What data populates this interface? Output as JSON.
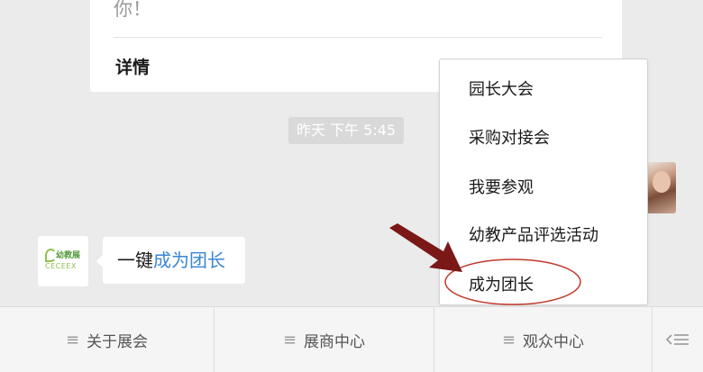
{
  "card": {
    "text_fragment": "你！",
    "detail_label": "详情",
    "chevron": "›"
  },
  "timestamp": "昨天 下午 5:45",
  "sender_logo": {
    "line1": "幼教展",
    "line2": "CECEEX"
  },
  "message": {
    "prefix": "一键",
    "link": "成为团长"
  },
  "popup_menu": {
    "items": [
      {
        "label": "园长大会"
      },
      {
        "label": "采购对接会"
      },
      {
        "label": "我要参观"
      },
      {
        "label": "幼教产品评选活动"
      },
      {
        "label": "成为团长"
      }
    ]
  },
  "tabbar": {
    "tabs": [
      {
        "label": "关于展会",
        "icon": "menu-lines-icon"
      },
      {
        "label": "展商中心",
        "icon": "menu-lines-icon"
      },
      {
        "label": "观众中心",
        "icon": "menu-lines-icon"
      }
    ],
    "toggle_icon": "keyboard-toggle-icon"
  },
  "colors": {
    "link": "#3a86d4",
    "annotation_red": "#7a1717",
    "background": "#ebebeb"
  }
}
